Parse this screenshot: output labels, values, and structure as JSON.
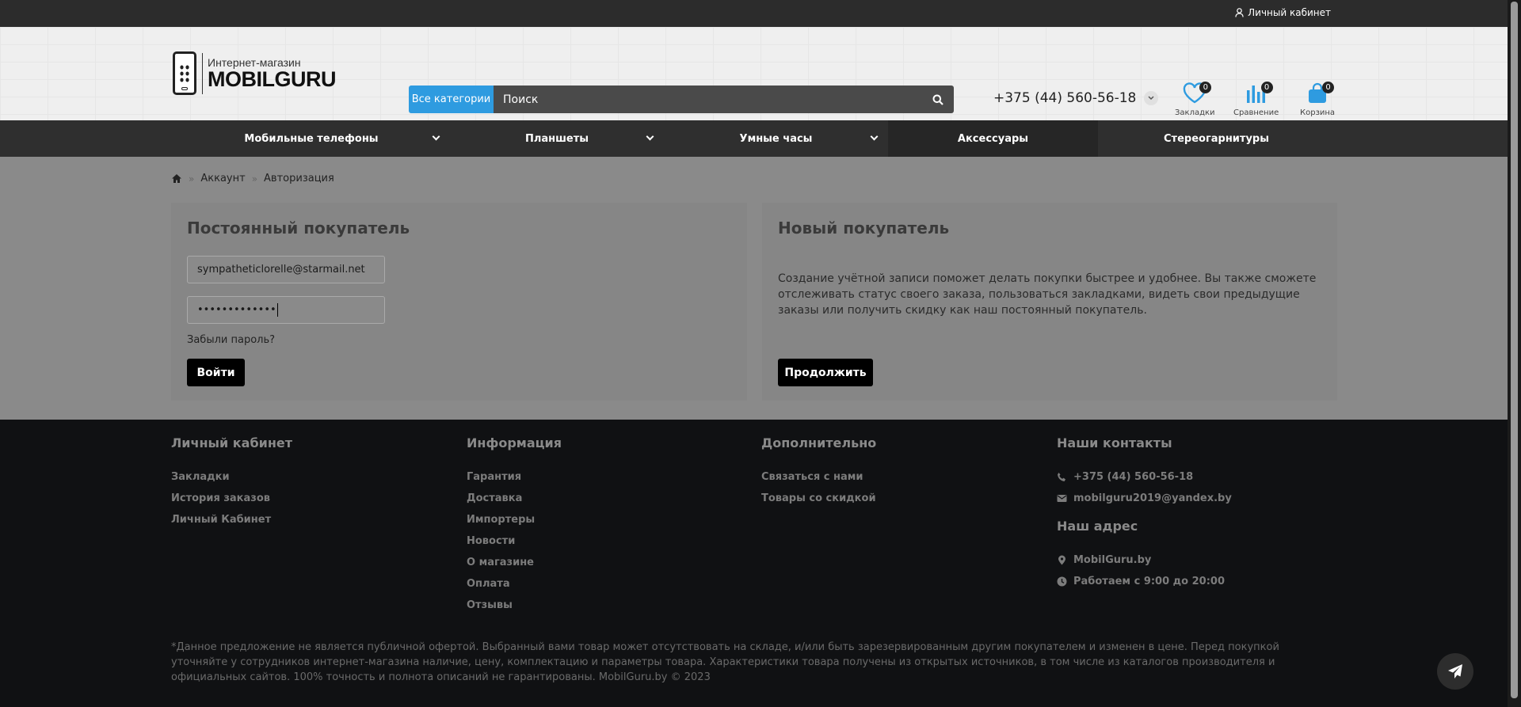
{
  "topbar": {
    "account_label": "Личный кабинет",
    "account_icon": "user-icon"
  },
  "header": {
    "logo_line1": "Интернет-магазин",
    "logo_line2": "MOBILGURU",
    "search": {
      "category_label": "Все категории",
      "placeholder": "Поиск",
      "icon": "search-icon"
    },
    "phone": "+375 (44) 560-56-18",
    "icons": [
      {
        "label": "Закладки",
        "count": "0",
        "icon": "heart-icon"
      },
      {
        "label": "Сравнение",
        "count": "0",
        "icon": "compare-bars-icon"
      },
      {
        "label": "Корзина",
        "count": "0",
        "icon": "shopping-bag-icon"
      }
    ]
  },
  "nav": {
    "items": [
      {
        "label": "Мобильные телефоны",
        "has_dropdown": true
      },
      {
        "label": "Планшеты",
        "has_dropdown": true
      },
      {
        "label": "Умные часы",
        "has_dropdown": true
      },
      {
        "label": "Аксессуары",
        "has_dropdown": false
      },
      {
        "label": "Стереогарнитуры",
        "has_dropdown": false
      }
    ]
  },
  "breadcrumb": {
    "items": [
      "Аккаунт",
      "Авторизация"
    ],
    "home_icon": "home-icon"
  },
  "login": {
    "title": "Постоянный покупатель",
    "email_value": "sympatheticlorelle@starmail.net",
    "password_value": "•••••••••••••",
    "forgot_label": "Забыли пароль?",
    "submit_label": "Войти"
  },
  "register": {
    "title": "Новый покупатель",
    "text": "Создание учётной записи поможет делать покупки быстрее и удобнее. Вы также сможете отслеживать статус своего заказа, пользоваться закладками, видеть свои предыдущие заказы или получить скидку как наш постоянный покупатель.",
    "continue_label": "Продолжить"
  },
  "footer": {
    "account": {
      "title": "Личный кабинет",
      "links": [
        "Закладки",
        "История заказов",
        "Личный Кабинет"
      ]
    },
    "info": {
      "title": "Информация",
      "links": [
        "Гарантия",
        "Доставка",
        "Импортеры",
        "Новости",
        "О магазине",
        "Оплата",
        "Отзывы"
      ]
    },
    "extra": {
      "title": "Дополнительно",
      "links": [
        "Связаться с нами",
        "Товары со скидкой"
      ]
    },
    "contacts": {
      "title": "Наши контакты",
      "phone": "+375 (44) 560-56-18",
      "email": "mobilguru2019@yandex.by",
      "address_title": "Наш адрес",
      "address": "MobilGuru.by",
      "hours": "Работаем с 9:00 до 20:00"
    },
    "disclaimer": "*Данное предложение не является публичной офертой. Выбранный вами товар может отсутствовать на складе, и/или быть зарезервированным другим покупателем и изменен в цене. Перед покупкой уточняйте у сотрудников интернет-магазина наличие, цену, комплектацию и параметры товара. Характеристики товара получены из открытых источников, в том числе из каталогов производителя и официальных сайтов. 100% точность и полнота описаний не гарантированы. MobilGuru.by © 2023"
  },
  "colors": {
    "accent": "#2e9be0",
    "nav_bg": "#2f2f2f",
    "footer_bg": "#101113"
  }
}
